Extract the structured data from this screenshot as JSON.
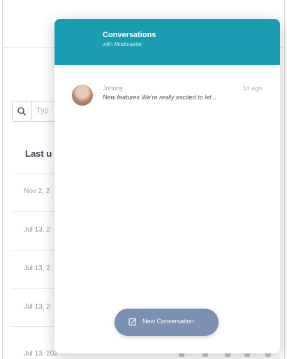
{
  "page": {
    "search_placeholder": "Typ",
    "column_header": "Last u",
    "rows": [
      "Nov 2, 2",
      "Jul 13, 2",
      "Jul 13, 2",
      "Jul 13, 2",
      "Jul 13, 2"
    ],
    "last_row": "Jul 13, 202"
  },
  "widget": {
    "title": "Conversations",
    "subtitle": "with Modmaster",
    "accent": "#1a9cb3",
    "conversation": {
      "name": "Johnny",
      "time": "1d ago",
      "preview": "New features We're really excited to let..."
    },
    "new_button": {
      "label": "New Conversation",
      "icon": "compose-icon",
      "color": "#7b90b2"
    }
  }
}
